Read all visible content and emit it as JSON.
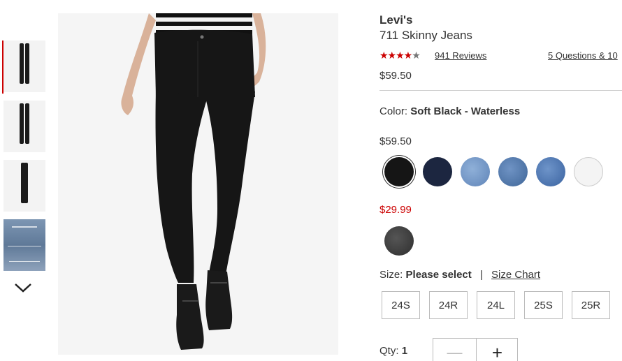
{
  "product": {
    "brand": "Levi's",
    "name": "711 Skinny Jeans",
    "rating_stars": "★★★★★",
    "rating_value": 4.5,
    "reviews": "941 Reviews",
    "questions": "5 Questions & 10",
    "price": "$59.50"
  },
  "color": {
    "label": "Color:",
    "selected": "Soft Black - Waterless",
    "group_a_price": "$59.50",
    "group_a_swatches": [
      "#151515",
      "#1c2640",
      "#6c8fc2",
      "#4f73a3",
      "#4a73a8",
      "#f2f2f2"
    ],
    "group_b_price": "$29.99",
    "group_b_swatches": [
      "#3a3a3a"
    ]
  },
  "size": {
    "label": "Size:",
    "selected": "Please select",
    "separator": "|",
    "chart_link": "Size Chart",
    "options": [
      "24S",
      "24R",
      "24L",
      "25S",
      "25R"
    ]
  },
  "quantity": {
    "label": "Qty:",
    "value": "1",
    "minus": "—",
    "plus": "+"
  },
  "colors": {
    "accent": "#cc0000",
    "text": "#333333"
  },
  "icons": {
    "chevron": "chevron-down-icon"
  }
}
